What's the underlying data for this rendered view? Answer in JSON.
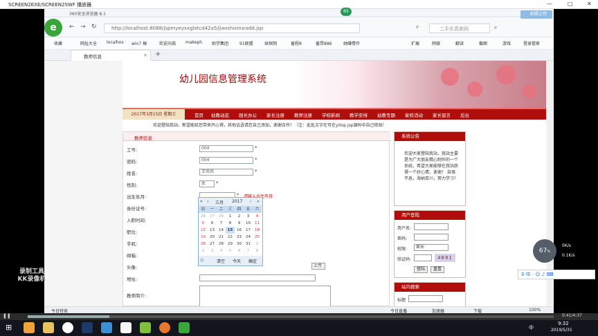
{
  "player": {
    "title": "SCREEN2EXE/SCREEN2SWF 播放器",
    "progress_time": "0:41/4:37"
  },
  "browser": {
    "name": "360安全浏览器 8.1",
    "url": "http://localhost:8088/jspmyeyxxglxtcd42a5/jiaoshixinxiadd.jsp",
    "search_placeholder": "二手车真卖网",
    "bookmarks": [
      "收藏",
      "网址大全",
      "localhos",
      "win7 搞",
      "欢迎光临",
      "makeph",
      "助学集团",
      "91联盟",
      "球探网",
      "童程8",
      "童昂886",
      "她嫌情作"
    ],
    "tab_title": "教师信息",
    "right_menu": [
      "扩展",
      "网银",
      "翻译",
      "截图",
      "游戏",
      "登录管家"
    ],
    "status_left": "今日特卖",
    "status_right": [
      "今日直播",
      "加速器",
      "下载",
      "100%"
    ],
    "badge": "65"
  },
  "site": {
    "title": "幼儿园信息管理系统",
    "date": "2017年3月15日 星期三",
    "nav": [
      "首页",
      "幼教动态",
      "园长办公",
      "家长注册",
      "教师注册",
      "学校新闻",
      "教学安排",
      "幼教专题",
      "家校活动",
      "家长留言",
      "后台"
    ],
    "welcome": "欢迎登陆我站，新望能给您带来开心得，其他话语请您自己添加，谢谢合作！（注：此处文字在可在yitop.jsp源码中自己修改）",
    "form": {
      "header": "教师信息",
      "fields": [
        {
          "label": "工号:",
          "value": "004"
        },
        {
          "label": "密码:",
          "value": "004"
        },
        {
          "label": "姓名:",
          "value": "王伟伟"
        },
        {
          "label": "性别:",
          "value": "女"
        },
        {
          "label": "出生年月:",
          "value": "",
          "hint": "请输入出生年月"
        },
        {
          "label": "身份证号:",
          "value": ""
        },
        {
          "label": "入职时间:",
          "value": ""
        },
        {
          "label": "职位:",
          "value": ""
        },
        {
          "label": "手机:",
          "value": ""
        },
        {
          "label": "邮箱:",
          "value": ""
        },
        {
          "label": "头像:",
          "value": ""
        },
        {
          "label": "地址:",
          "value": ""
        },
        {
          "label": "教师简介:",
          "value": ""
        }
      ],
      "upload_label": "上传"
    },
    "calendar": {
      "month": "三月",
      "year": "2017",
      "week": [
        "日",
        "一",
        "二",
        "三",
        "四",
        "五",
        "六"
      ],
      "days": [
        [
          "26",
          "27",
          "28",
          "1",
          "2",
          "3",
          "4"
        ],
        [
          "5",
          "6",
          "7",
          "8",
          "9",
          "10",
          "11"
        ],
        [
          "12",
          "13",
          "14",
          "15",
          "16",
          "17",
          "18"
        ],
        [
          "19",
          "20",
          "21",
          "22",
          "23",
          "24",
          "25"
        ],
        [
          "26",
          "27",
          "28",
          "29",
          "30",
          "31",
          "1"
        ],
        [
          "2",
          "3",
          "4",
          "5",
          "6",
          "7",
          "8"
        ]
      ],
      "selected": "15",
      "clear": "清空",
      "today": "今天",
      "ok": "确定"
    },
    "side": {
      "notice_title": "系统公告",
      "notice_text": "欢迎大家登陆我站，我站主要是为广大朋友精心制作的一个系统，希望大家能够在我站获得一个好心情，谢谢！ 自强不息，海纳百川，努力学习！",
      "login_title": "用户登陆",
      "login_labels": [
        "用户名:",
        "密码:",
        "权限:",
        "验证码:"
      ],
      "role_value": "家长",
      "captcha": "4691",
      "login_btn": "登陆",
      "reset_btn": "重置",
      "search_title": "站内搜索",
      "search_label": "标题"
    }
  },
  "overlay": {
    "watermark_line1": "录制工具",
    "watermark_line2": "KK录像机",
    "speed": "67",
    "speed_unit": "%",
    "net_up": "0K/s",
    "net_down": "0.1K/s",
    "upload_btn": "拍照上传"
  },
  "taskbar": {
    "time": "9:32",
    "date": "2019/5/31",
    "ime": "中"
  }
}
